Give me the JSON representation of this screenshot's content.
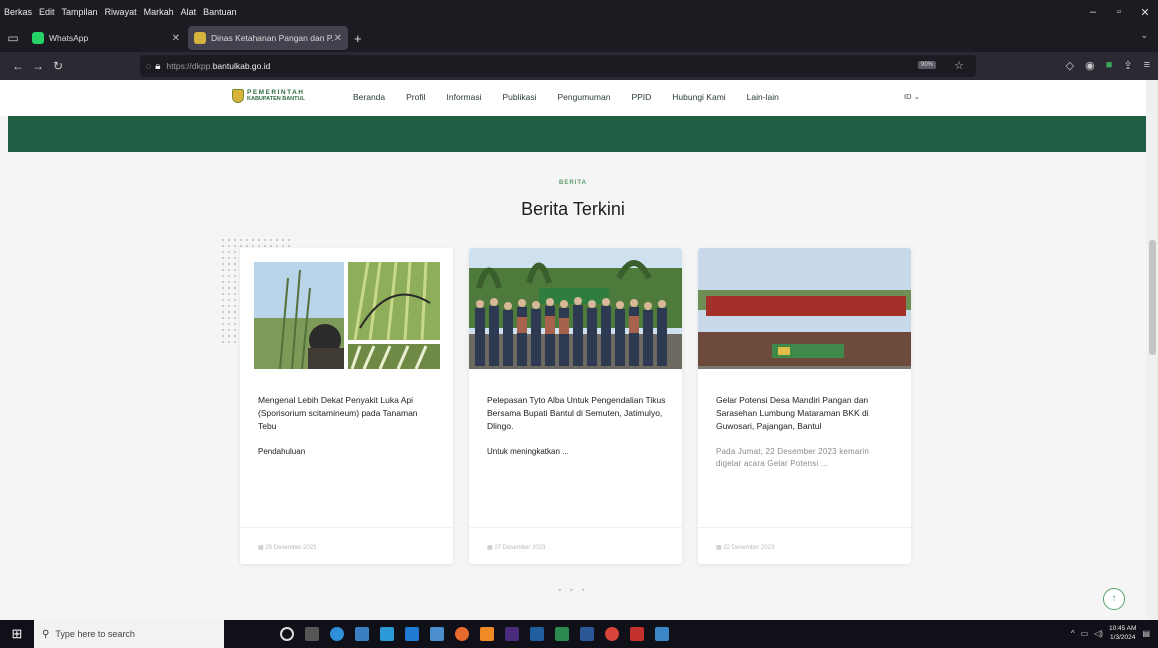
{
  "window": {
    "menu": [
      "Berkas",
      "Edit",
      "Tampilan",
      "Riwayat",
      "Markah",
      "Alat",
      "Bantuan"
    ],
    "controls": {
      "minimize": "–",
      "maximize": "▫",
      "close": "✕"
    }
  },
  "tabs": [
    {
      "title": "WhatsApp",
      "favicon_color": "#25d366",
      "active": false
    },
    {
      "title": "Dinas Ketahanan Pangan dan P...",
      "favicon_color": "#d4b43a",
      "active": true
    }
  ],
  "navbar": {
    "url_hint": "https://dkpp.",
    "url_domain": "bantulkab.go.id",
    "zoom_badge": "90%"
  },
  "site": {
    "logo_line1": "PEMERINTAH",
    "logo_line2": "KABUPATEN BANTUL",
    "menu": [
      "Beranda",
      "Profil",
      "Informasi",
      "Publikasi",
      "Pengumuman",
      "PPID",
      "Hubungi Kami",
      "Lain-lain"
    ],
    "lang": "ID ⌄",
    "primary_color": "#1f5e42"
  },
  "section": {
    "kicker": "BERITA",
    "title": "Berita Terkini"
  },
  "cards": [
    {
      "title": "Mengenal Lebih Dekat Penyakit Luka Api (Sporisorium scitamineum) pada Tanaman Tebu",
      "excerpt": "Pendahuluan",
      "date": "29 Desember 2023"
    },
    {
      "title": "Pelepasan Tyto Alba Untuk Pengendalian Tikus Bersama Bupati Bantul di Semuten, Jatimulyo, Dlingo.",
      "excerpt": "Untuk meningkatkan ...",
      "date": "27 Desember 2023"
    },
    {
      "title": "Gelar Potensi Desa Mandiri Pangan dan Sarasehan Lumbung Mataraman BKK di Guwosari, Pajangan, Bantul",
      "excerpt": "Pada Jumat, 22 Desember 2023 kemarin digelar acara Gelar Potensi ...",
      "date": "22 Desember 2023"
    }
  ],
  "pager": "• • •",
  "taskbar": {
    "search_placeholder": "Type here to search",
    "time": "10:45 AM",
    "date": "1/3/2024"
  }
}
